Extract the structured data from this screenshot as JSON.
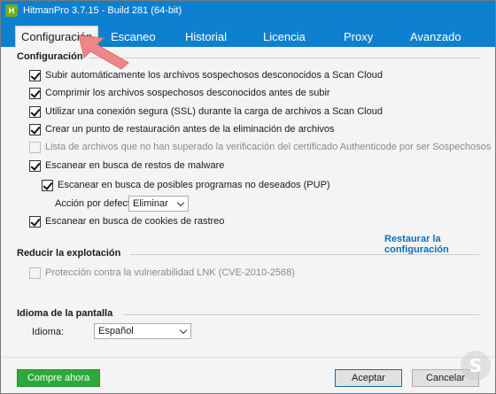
{
  "window": {
    "title": "HitmanPro 3.7.15 - Build 281 (64-bit)",
    "app_icon_letter": "H"
  },
  "tabs": [
    {
      "label": "Configuración",
      "active": true
    },
    {
      "label": "Escaneo",
      "active": false
    },
    {
      "label": "Historial",
      "active": false
    },
    {
      "label": "Licencia",
      "active": false
    },
    {
      "label": "Proxy",
      "active": false
    },
    {
      "label": "Avanzado",
      "active": false
    }
  ],
  "config_group": {
    "title": "Configuración",
    "options": [
      {
        "label": "Subir automáticamente los archivos sospechosos desconocidos a Scan Cloud",
        "checked": true,
        "disabled": false
      },
      {
        "label": "Comprimir los archivos sospechosos desconocidos antes de subir",
        "checked": true,
        "disabled": false
      },
      {
        "label": "Utilizar una conexión segura (SSL) durante la carga de archivos a Scan Cloud",
        "checked": true,
        "disabled": false
      },
      {
        "label": "Crear un punto de restauración antes de la eliminación de archivos",
        "checked": true,
        "disabled": false
      },
      {
        "label": "Lista de archivos que no han superado la verificación del certificado Authenticode por ser Sospechosos",
        "checked": false,
        "disabled": true
      },
      {
        "label": "Escanear en busca de restos de malware",
        "checked": true,
        "disabled": false
      },
      {
        "label": "Escanear en busca de posibles programas no deseados (PUP)",
        "checked": true,
        "disabled": false
      },
      {
        "label": "Escanear en busca de cookies de rastreo",
        "checked": true,
        "disabled": false
      }
    ],
    "default_action_label": "Acción por defecto:",
    "default_action_value": "Eliminar",
    "restore_link": "Restaurar la configuración"
  },
  "exploit_group": {
    "title": "Reducir la explotación",
    "option": {
      "label": "Protección contra la vulnerabilidad LNK (CVE-2010-2568)",
      "checked": false,
      "disabled": true
    }
  },
  "language_group": {
    "title": "Idioma de la pantalla",
    "label": "Idioma:",
    "value": "Español"
  },
  "footer": {
    "buy_label": "Compre ahora",
    "accept_label": "Aceptar",
    "cancel_label": "Cancelar"
  },
  "watermark_letter": "S",
  "colors": {
    "titlebar": "#0e80d0",
    "buy_button": "#2ea83a",
    "link": "#0b6fbf",
    "arrow": "#f08585"
  }
}
